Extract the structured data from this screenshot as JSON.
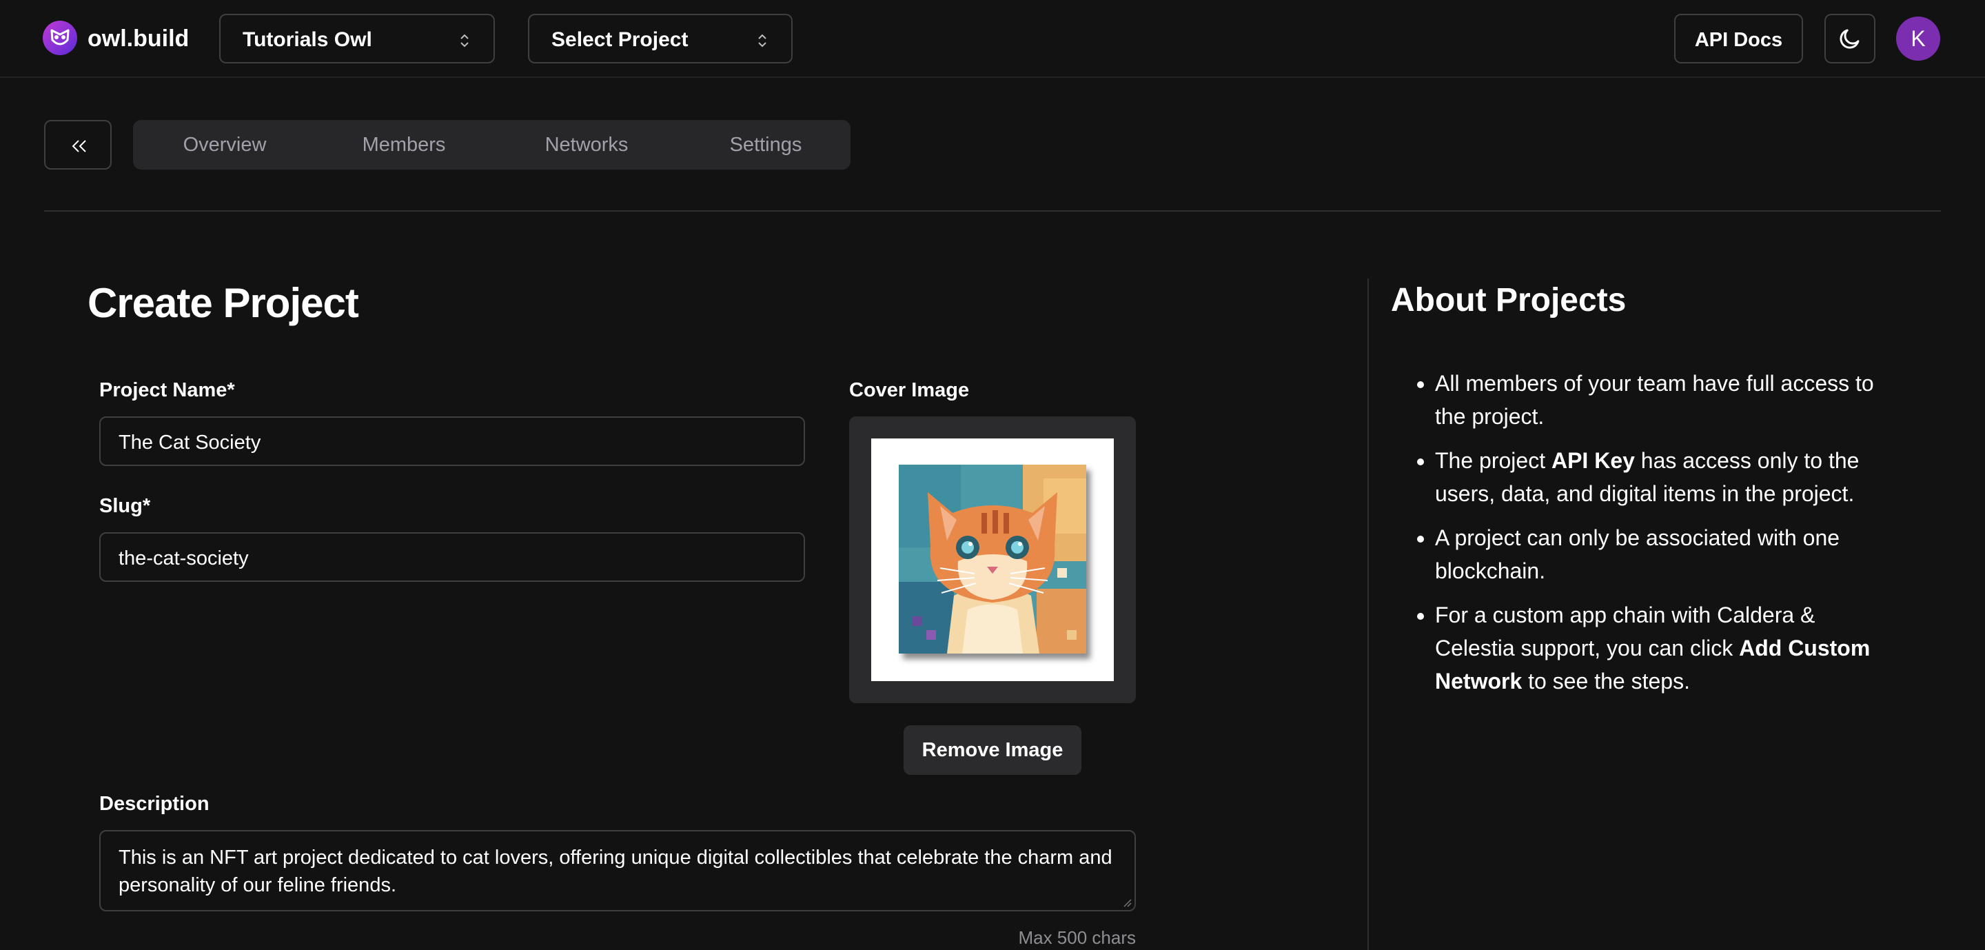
{
  "header": {
    "brand": "owl.build",
    "team_select": "Tutorials Owl",
    "project_select": "Select Project",
    "api_docs": "API Docs",
    "avatar_initial": "K"
  },
  "tabs": [
    "Overview",
    "Members",
    "Networks",
    "Settings"
  ],
  "form": {
    "title": "Create Project",
    "project_name_label": "Project Name*",
    "project_name_value": "The Cat Society",
    "slug_label": "Slug*",
    "slug_value": "the-cat-society",
    "cover_label": "Cover Image",
    "remove_image": "Remove Image",
    "description_label": "Description",
    "description_value": "This is an NFT art project dedicated to cat lovers, offering unique digital collectibles that celebrate the charm and personality of our feline friends.",
    "description_hint": "Max 500 chars"
  },
  "about": {
    "title": "About Projects",
    "items": [
      {
        "pre": "All members of your team have full access to the project.",
        "bold": "",
        "post": ""
      },
      {
        "pre": "The project ",
        "bold": "API Key",
        "post": " has access only to the users, data, and digital items in the project."
      },
      {
        "pre": "A project can only be associated with one blockchain.",
        "bold": "",
        "post": ""
      },
      {
        "pre": "For a custom app chain with Caldera & Celestia support, you can click ",
        "bold": "Add Custom Network",
        "post": " to see the steps."
      }
    ]
  },
  "colors": {
    "background": "#121212",
    "accent": "#7b2fb0",
    "border": "#3f3f3f",
    "muted_text": "#a1a1aa"
  }
}
